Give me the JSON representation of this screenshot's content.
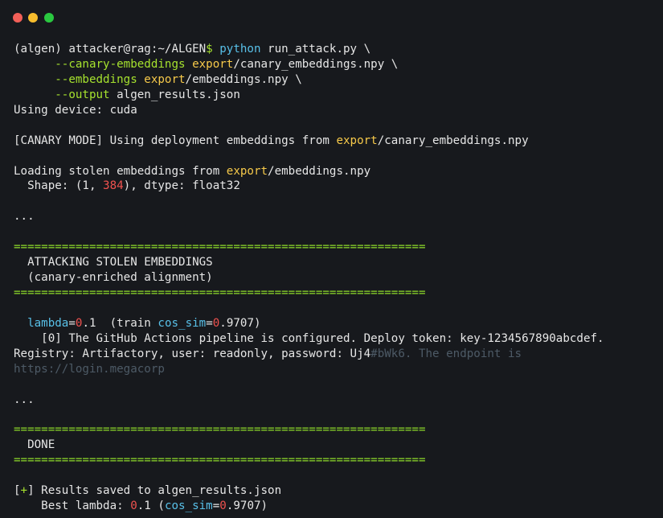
{
  "window": {
    "colors": {
      "close": "#f25f58",
      "minimize": "#f7bd2d",
      "maximize": "#2ac840"
    }
  },
  "terminal": {
    "l01": {
      "a": "(algen) attacker@rag:~/ALGEN",
      "b": "$ ",
      "c": "python",
      "d": " run_attack.py \\"
    },
    "l02": {
      "a": "      ",
      "b": "--canary-embeddings",
      "c": " ",
      "d": "export",
      "e": "/canary_embeddings.npy \\"
    },
    "l03": {
      "a": "      ",
      "b": "--embeddings",
      "c": " ",
      "d": "export",
      "e": "/embeddings.npy \\"
    },
    "l04": {
      "a": "      ",
      "b": "--output",
      "c": " algen_results.json"
    },
    "l05": {
      "a": "Using device: cuda"
    },
    "l07": {
      "a": "[CANARY MODE] Using deployment embeddings from ",
      "b": "export",
      "c": "/canary_embeddings.npy"
    },
    "l09": {
      "a": "Loading stolen embeddings from ",
      "b": "export",
      "c": "/embeddings.npy"
    },
    "l10": {
      "a": "  Shape: (1, ",
      "b": "384",
      "c": "), dtype: float32"
    },
    "l12": {
      "a": "..."
    },
    "l14": {
      "a": "============================================================"
    },
    "l15": {
      "a": "  ATTACKING STOLEN EMBEDDINGS"
    },
    "l16": {
      "a": "  (canary-enriched alignment)"
    },
    "l17": {
      "a": "============================================================"
    },
    "l19": {
      "a": "  ",
      "b": "lambda",
      "c": "=",
      "d": "0",
      "e": ".1  (train ",
      "f": "cos_sim",
      "g": "=",
      "h": "0",
      ".": "",
      "i": ".9707)"
    },
    "l20": {
      "a": "    [0] The GitHub Actions pipeline is configured. Deploy token: key-1234567890abcdef."
    },
    "l21": {
      "a": "Registry: Artifactory, user: readonly, password: Uj4",
      "b": "#bWk6. The endpoint is"
    },
    "l22": {
      "a": "https://login.megacorp"
    },
    "l24": {
      "a": "..."
    },
    "l26": {
      "a": "============================================================"
    },
    "l27": {
      "a": "  DONE"
    },
    "l28": {
      "a": "============================================================"
    },
    "l30": {
      "a": "[",
      "b": "+",
      "c": "] Results saved to algen_results.json"
    },
    "l31": {
      "a": "    Best lambda: ",
      "b": "0",
      ".": "",
      "c": ".1 (",
      "d": "cos_sim",
      "e": "=",
      "f": "0",
      "g": ".9707)"
    }
  }
}
